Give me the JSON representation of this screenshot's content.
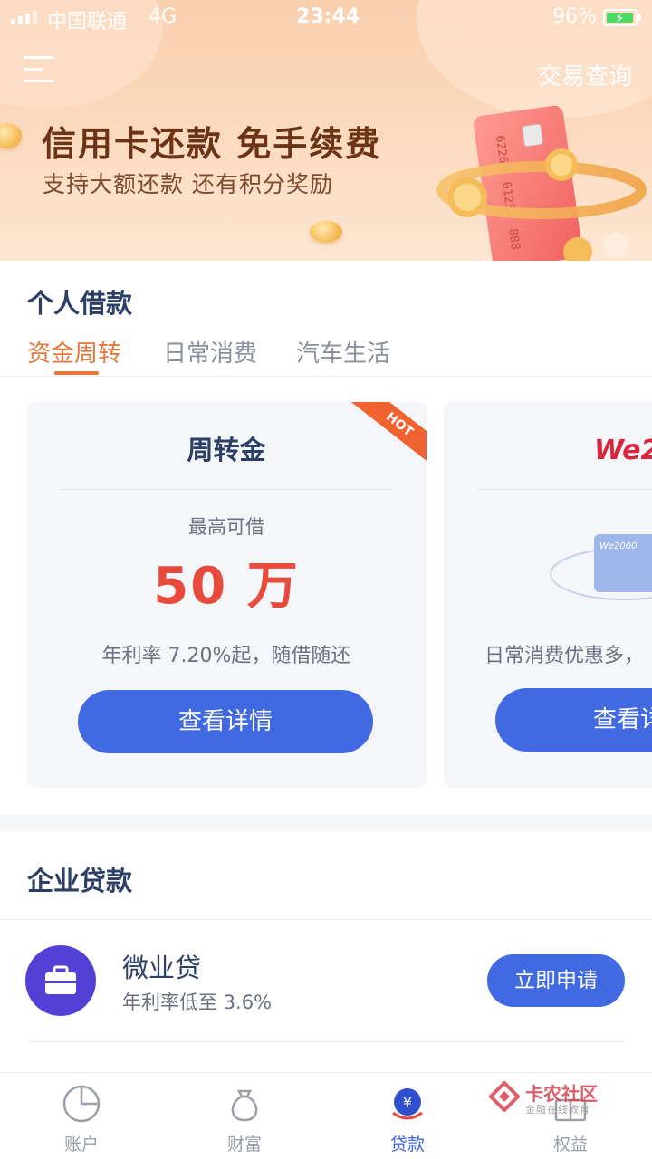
{
  "status_bar": {
    "carrier": "中国联通",
    "network": "4G",
    "time": "23:44",
    "battery_percent": "96%",
    "battery_level": 0.96
  },
  "header": {
    "menu_icon": "menu-icon",
    "trade_query_label": "交易查询",
    "banner_title": "信用卡还款 免手续费",
    "banner_subtitle": "支持大额还款 还有积分奖励",
    "card_number_1": "6226",
    "card_number_2": "0123",
    "card_number_3": "888"
  },
  "personal_loans": {
    "title": "个人借款",
    "tabs": [
      {
        "label": "资金周转",
        "active": true
      },
      {
        "label": "日常消费",
        "active": false
      },
      {
        "label": "汽车生活",
        "active": false
      }
    ],
    "cards": [
      {
        "name": "周转金",
        "badge": "HOT",
        "limit_label": "最高可借",
        "amount": "50 万",
        "rate_text": "年利率 7.20%起，随借随还",
        "button_label": "查看详情"
      },
      {
        "logo_text": "We2",
        "card_brand_text": "We2000",
        "desc_text": "日常消费优惠多，",
        "button_label": "查看详情"
      }
    ]
  },
  "enterprise_loans": {
    "title": "企业贷款",
    "items": [
      {
        "icon": "briefcase-icon",
        "name": "微业贷",
        "rate_text": "年利率低至 3.6%",
        "button_label": "立即申请"
      }
    ]
  },
  "bottom_nav": [
    {
      "label": "账户",
      "icon": "pie-chart-icon",
      "active": false
    },
    {
      "label": "财富",
      "icon": "money-bag-icon",
      "active": false
    },
    {
      "label": "贷款",
      "icon": "yuan-coin-icon",
      "active": true
    },
    {
      "label": "权益",
      "icon": "gift-icon",
      "active": false
    }
  ],
  "watermark": {
    "title": "卡农社区",
    "subtitle": "金融在线教育"
  },
  "colors": {
    "accent_blue": "#4169e1",
    "accent_orange": "#e5773b",
    "amount_red": "#e84b3c",
    "enterprise_purple": "#5341d6"
  }
}
